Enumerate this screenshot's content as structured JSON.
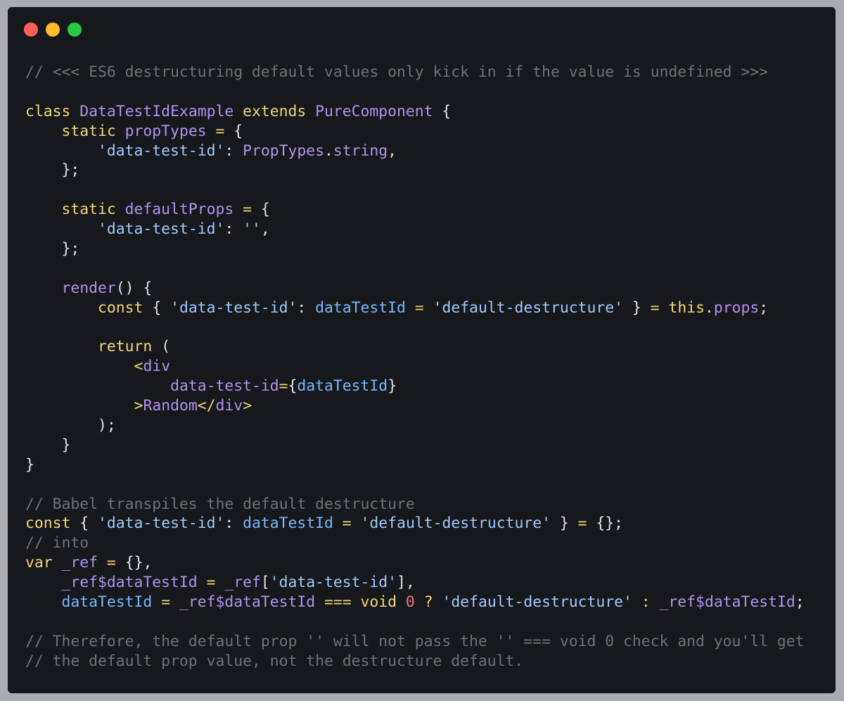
{
  "window": {
    "controls": [
      {
        "name": "close",
        "color": "#ff5f57"
      },
      {
        "name": "minimize",
        "color": "#febc2e"
      },
      {
        "name": "zoom",
        "color": "#28c840"
      }
    ]
  },
  "colors": {
    "background": "#a9adb1",
    "editor": "#16181c",
    "comment": "#6a737d",
    "keyword": "#f2d77a",
    "type": "#b392f0",
    "string": "#9ecbff",
    "number": "#f97583",
    "text": "#e1e4e8"
  },
  "code_lines": [
    [
      [
        "comment",
        "// <<< ES6 destructuring default values only kick in if the value is undefined >>>"
      ]
    ],
    [],
    [
      [
        "keyword",
        "class "
      ],
      [
        "type",
        "DataTestIdExample "
      ],
      [
        "keyword",
        "extends "
      ],
      [
        "type",
        "PureComponent "
      ],
      [
        "punct",
        "{"
      ]
    ],
    [
      [
        "plain",
        "    "
      ],
      [
        "keyword",
        "static "
      ],
      [
        "prop",
        "propTypes "
      ],
      [
        "op",
        "= "
      ],
      [
        "punct",
        "{"
      ]
    ],
    [
      [
        "plain",
        "        "
      ],
      [
        "string",
        "'data-test-id'"
      ],
      [
        "punct",
        ": "
      ],
      [
        "type",
        "PropTypes"
      ],
      [
        "punct",
        "."
      ],
      [
        "prop",
        "string"
      ],
      [
        "punct",
        ","
      ]
    ],
    [
      [
        "plain",
        "    "
      ],
      [
        "punct",
        "};"
      ]
    ],
    [],
    [
      [
        "plain",
        "    "
      ],
      [
        "keyword",
        "static "
      ],
      [
        "prop",
        "defaultProps "
      ],
      [
        "op",
        "= "
      ],
      [
        "punct",
        "{"
      ]
    ],
    [
      [
        "plain",
        "        "
      ],
      [
        "string",
        "'data-test-id'"
      ],
      [
        "punct",
        ": "
      ],
      [
        "string",
        "''"
      ],
      [
        "punct",
        ","
      ]
    ],
    [
      [
        "plain",
        "    "
      ],
      [
        "punct",
        "};"
      ]
    ],
    [],
    [
      [
        "plain",
        "    "
      ],
      [
        "prop",
        "render"
      ],
      [
        "punct",
        "() {"
      ]
    ],
    [
      [
        "plain",
        "        "
      ],
      [
        "keyword",
        "const "
      ],
      [
        "punct",
        "{ "
      ],
      [
        "string",
        "'data-test-id'"
      ],
      [
        "punct",
        ": "
      ],
      [
        "ident",
        "dataTestId "
      ],
      [
        "op",
        "= "
      ],
      [
        "string",
        "'default-destructure' "
      ],
      [
        "punct",
        "} "
      ],
      [
        "op",
        "= "
      ],
      [
        "keyword",
        "this"
      ],
      [
        "punct",
        "."
      ],
      [
        "prop",
        "props"
      ],
      [
        "punct",
        ";"
      ]
    ],
    [],
    [
      [
        "plain",
        "        "
      ],
      [
        "keyword",
        "return "
      ],
      [
        "punct",
        "("
      ]
    ],
    [
      [
        "plain",
        "            "
      ],
      [
        "op",
        "<"
      ],
      [
        "prop",
        "div"
      ]
    ],
    [
      [
        "plain",
        "                "
      ],
      [
        "prop",
        "data-test-id"
      ],
      [
        "op",
        "="
      ],
      [
        "punct",
        "{"
      ],
      [
        "ident",
        "dataTestId"
      ],
      [
        "punct",
        "}"
      ]
    ],
    [
      [
        "plain",
        "            "
      ],
      [
        "op",
        ">"
      ],
      [
        "prop",
        "Random"
      ],
      [
        "op",
        "</"
      ],
      [
        "prop",
        "div"
      ],
      [
        "op",
        ">"
      ]
    ],
    [
      [
        "plain",
        "        "
      ],
      [
        "punct",
        ");"
      ]
    ],
    [
      [
        "plain",
        "    "
      ],
      [
        "punct",
        "}"
      ]
    ],
    [
      [
        "punct",
        "}"
      ]
    ],
    [],
    [
      [
        "comment",
        "// Babel transpiles the default destructure"
      ]
    ],
    [
      [
        "keyword",
        "const "
      ],
      [
        "punct",
        "{ "
      ],
      [
        "string",
        "'data-test-id'"
      ],
      [
        "punct",
        ": "
      ],
      [
        "ident",
        "dataTestId "
      ],
      [
        "op",
        "= "
      ],
      [
        "string",
        "'default-destructure' "
      ],
      [
        "punct",
        "} "
      ],
      [
        "op",
        "= "
      ],
      [
        "punct",
        "{};"
      ]
    ],
    [
      [
        "comment",
        "// into"
      ]
    ],
    [
      [
        "keyword",
        "var "
      ],
      [
        "prop",
        "_ref "
      ],
      [
        "op",
        "= "
      ],
      [
        "punct",
        "{},"
      ]
    ],
    [
      [
        "plain",
        "    "
      ],
      [
        "prop",
        "_ref$dataTestId "
      ],
      [
        "op",
        "= "
      ],
      [
        "prop",
        "_ref"
      ],
      [
        "punct",
        "["
      ],
      [
        "string",
        "'data-test-id'"
      ],
      [
        "punct",
        "],"
      ]
    ],
    [
      [
        "plain",
        "    "
      ],
      [
        "ident",
        "dataTestId "
      ],
      [
        "op",
        "= "
      ],
      [
        "prop",
        "_ref$dataTestId "
      ],
      [
        "op",
        "=== void "
      ],
      [
        "num",
        "0 "
      ],
      [
        "op",
        "? "
      ],
      [
        "string",
        "'default-destructure' "
      ],
      [
        "op",
        ": "
      ],
      [
        "prop",
        "_ref$dataTestId"
      ],
      [
        "punct",
        ";"
      ]
    ],
    [],
    [
      [
        "comment",
        "// Therefore, the default prop '' will not pass the '' === void 0 check and you'll get"
      ]
    ],
    [
      [
        "comment",
        "// the default prop value, not the destructure default."
      ]
    ]
  ]
}
